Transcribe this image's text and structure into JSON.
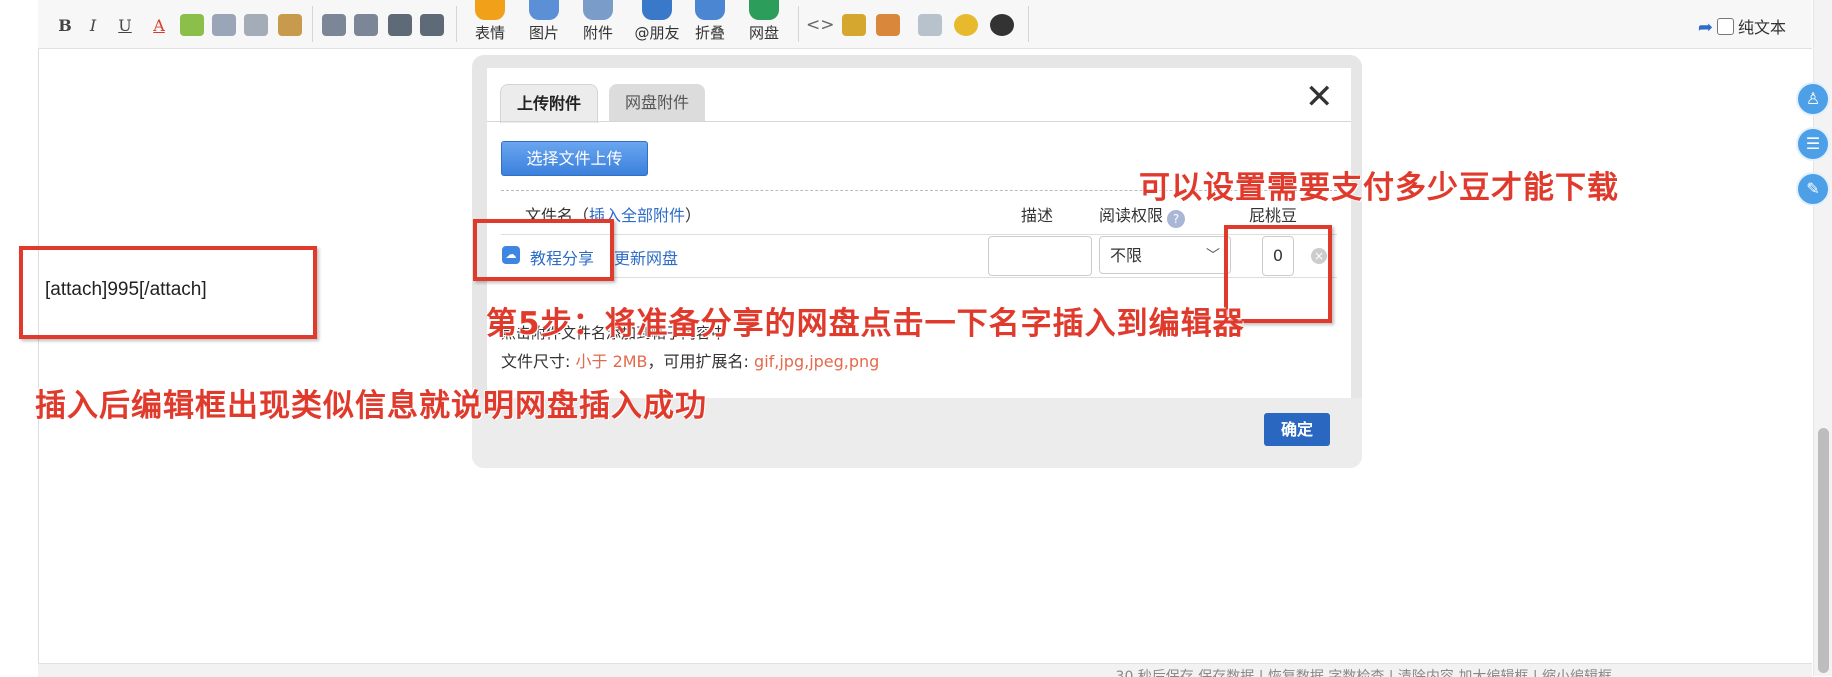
{
  "toolbar": {
    "format_buttons": [
      "B",
      "I",
      "U",
      "A"
    ],
    "insert_buttons": [
      {
        "label": "表情",
        "icon": "emoji-icon",
        "color": "#f0a019"
      },
      {
        "label": "图片",
        "icon": "image-icon",
        "color": "#5b8fd6"
      },
      {
        "label": "附件",
        "icon": "attachment-icon",
        "color": "#7a9cc8"
      },
      {
        "label": "@朋友",
        "icon": "at-icon",
        "color": "#3a78c9"
      },
      {
        "label": "折叠",
        "icon": "fold-icon",
        "color": "#4a86d2"
      },
      {
        "label": "网盘",
        "icon": "netdisk-icon",
        "color": "#2d9d5b"
      }
    ],
    "plain_text_label": "纯文本"
  },
  "editor": {
    "content": "[attach]995[/attach]"
  },
  "dialog": {
    "tabs": [
      "上传附件",
      "网盘附件"
    ],
    "upload_button": "选择文件上传",
    "headers": {
      "file_prefix": "文件名（",
      "insert_all": "插入全部附件",
      "file_suffix": "）",
      "description": "描述",
      "permission": "阅读权限",
      "price": "屁桃豆"
    },
    "row": {
      "file_name": "教程分享",
      "refresh_link": "更新网盘",
      "permission_value": "不限",
      "price_value": "0"
    },
    "limit_prefix": "点击附件文件名添加到帖子内容中",
    "size_label": "文件尺寸: ",
    "size_value": "小于 2MB",
    "ext_label": "，可用扩展名: ",
    "ext_value": "gif,jpg,jpeg,png",
    "confirm_button": "确定"
  },
  "status_bar": {
    "text": "30 秒后保存 保存数据 | 恢复数据    字数检查 | 清除内容    加大编辑框 | 缩小编辑框"
  },
  "annotations": {
    "price_note": "可以设置需要支付多少豆才能下载",
    "step5_note": "第5步：将准备分享的网盘点击一下名字插入到编辑器",
    "success_note": "插入后编辑框出现类似信息就说明网盘插入成功"
  },
  "colors": {
    "annotation_red": "#e03a2c",
    "link_blue": "#2d6cc7",
    "confirm_blue": "#2a67c0",
    "limit_red": "#e4694a"
  }
}
